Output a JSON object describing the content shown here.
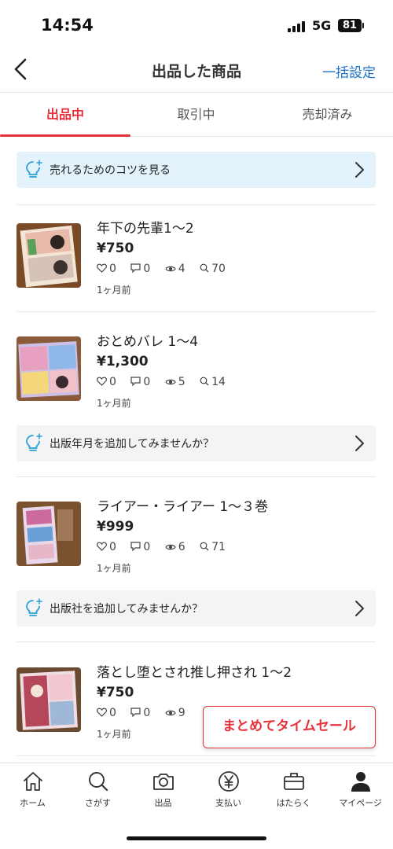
{
  "status_bar": {
    "time": "14:54",
    "network": "5G",
    "battery": "81"
  },
  "nav": {
    "title": "出品した商品",
    "bulk_settings": "一括設定"
  },
  "tabs": [
    {
      "label": "出品中",
      "active": true
    },
    {
      "label": "取引中",
      "active": false
    },
    {
      "label": "売却済み",
      "active": false
    }
  ],
  "tip_banner": {
    "text": "売れるためのコツを見る",
    "icon": "lightbulb-icon"
  },
  "items": [
    {
      "title": "年下の先輩1～2",
      "price": "¥750",
      "likes": "0",
      "comments": "0",
      "views": "4",
      "searches": "70",
      "date": "1ヶ月前"
    },
    {
      "title": "おとめバレ 1～4",
      "price": "¥1,300",
      "likes": "0",
      "comments": "0",
      "views": "5",
      "searches": "14",
      "date": "1ヶ月前"
    },
    {
      "title": "ライアー・ライアー 1～３巻",
      "price": "¥999",
      "likes": "0",
      "comments": "0",
      "views": "6",
      "searches": "71",
      "date": "1ヶ月前"
    },
    {
      "title": "落とし堕とされ推し押され 1～2",
      "price": "¥750",
      "likes": "0",
      "comments": "0",
      "views": "9",
      "searches": "",
      "date": "1ヶ月前"
    }
  ],
  "suggestions": [
    {
      "text": "出版年月を追加してみませんか？"
    },
    {
      "text": "出版社を追加してみませんか？"
    }
  ],
  "timesale_button": "まとめてタイムセール",
  "bottom_nav": [
    {
      "label": "ホーム",
      "icon": "home-icon"
    },
    {
      "label": "さがす",
      "icon": "search-icon"
    },
    {
      "label": "出品",
      "icon": "camera-icon"
    },
    {
      "label": "支払い",
      "icon": "yen-icon"
    },
    {
      "label": "はたらく",
      "icon": "briefcase-icon"
    },
    {
      "label": "マイページ",
      "icon": "person-icon"
    }
  ],
  "colors": {
    "accent_red": "#e8303a",
    "link_blue": "#1d72c4",
    "tip_bg": "#e4f3fb"
  }
}
